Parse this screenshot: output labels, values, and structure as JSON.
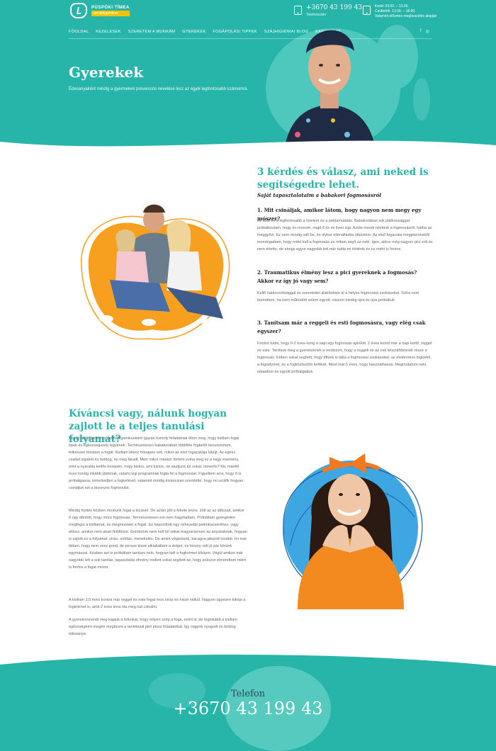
{
  "brand": {
    "name": "PÜSPÖKI TÍMEA",
    "tagline": "dentálhigiénikus",
    "accent_color": "#27b5aa",
    "secondary_color": "#f7a01f"
  },
  "header": {
    "phone": "+3670 43 199 43",
    "phone_label": "Telefonszám",
    "hours_line1": "Kedd: 09.00. – 13.00.",
    "hours_line2": "Csütörtök: 13.00. – 18.00.",
    "hours_line3": "Valamint előzetes megbeszélés alapján"
  },
  "nav": {
    "items": [
      "FŐOLDAL",
      "KEZELÉSEK",
      "SZERETEM A MUNKÁM",
      "GYEREKEK",
      "FOGÁPOLÁSI TIPPEK",
      "SZÁJHIGIÉNIAI BLOG",
      "KAPCSOLAT"
    ],
    "social": [
      "f",
      "instagram"
    ]
  },
  "hero": {
    "title": "Gyerekek",
    "lead": "Édesanyaként mindig a gyermekek prevenciós nevelése lesz az egyik legfontosabb számomra."
  },
  "section1": {
    "title": "3 kérdés és válasz, ami neked is segítségedre lehet.",
    "subtitle": "Saját tapasztalataim a babakori fogmosásról",
    "q1": "1. Mit csináljak, amikor látom, hogy nagyon nem megy egy mószer?",
    "a1": "Az első és a legfontosabb a türelem és a példamutatás. Babakorában sok játékossággal próbálkoztam, hogy én mosom, majd ő és mi ilyen izgi. Aztán mesét néztünk a fogmosásról, hátha az meggyőzi. Ez nem mindig vált be, és olykor ellenállásba ütköztem. Az első fogacska megjelenésétől mondogattam, hogy miért kell a fogmosás és miben segít az neki. Igen, akkor még nagyon pici volt és nem értette, de ahogy egyre nagyobb lett már tudta mi történik és ez miért is fontos.",
    "q2": "2. Traumatikus élmény lesz a pici gyereknek a fogmosás? Akkor ez így jó vagy sem?",
    "a2": "Kellő határozottsággal és szeretettel alakítottam ki a helyes fogmosási szokásokat. Soha nem büntettem, ha nem működött velem együtt, viszont mindig újra és újra próbáltuk.",
    "q3": "3. Tanítsam már a reggeli és esti fogmosásra, vagy elég csak egyszer?",
    "a3": "Fontos tudni, hogy 0-2 éves korig a napi egy fogmosás ajánlott. 2 éves kortól már a napi kettő, reggel és este. Tanítsuk meg a gyerekeknek a rendszert, hogy a reggeli és az esti készülődésnek része a fogmosás. Ebben sokat segített, hogy tőlünk is látta a fogmosási szokásokat, az elektromos fogkefét, a fogselymet, és a fogköztisztító kefékét. Most már 5 éves, hogy használhassa. Megmutatom neki, odaadom és együtt próbálgatjuk."
  },
  "section2": {
    "title": "Kíváncsi vagy, nálunk hogyan zajlott le a teljes tanulási folyamat?",
    "p1": "Kezdő anyukaként és dentálhigiénikusként igazán komoly feladatnak élem meg, hogy kisfiam fogai épek és egészségesek legyenek. Természetesen babakorában többféle fogkefét beszereztem, felkészen mostam a fogát. Kisfiam kilenc hónapos volt, mikor az első fogacskája kibújt. Az egész család izgatott és boldog, no meg fáradt. Mert mikor máskor történt volna meg ez a nagy esemény, mint a nyaralás kellős közepén, hogy biztos, ami biztos, ne aludjunk túl sokat. Ismerős? Kb. másfél éves koráig inkább játéknak, valami izgi programnak fogta fel a fogmosást. Figyeltem arra, hogy ő is próbálgassa, ismerkedjen a fogkefével, valamint mindig kíváncsian szemlélte, hogy mi szülők hogyan csináljuk ezt a bizonyos fogmosást.",
    "p2": "Mindig fürdés közben mostunk fogat a kicsivel. De aztán jött a fekete leves. Jött az az időszak, amikor ő úgy döntött, hogy nincs fogmosás. Természetesen ezt nem hagyhattam. Próbáltam gyengéden megfogni a kisfiamat, és megmostam a fogát. Ez hasonlított egy nehezebb pelenkacseréhez, vagy ahhoz, amikor nem akart felöltözni. Gondolom nem kell túl sokat magyaráznom az anyukáknak, hogyan is zajlott ez a folyamat: sírás, ordítás, menekülés. De amint végeztünk, kacagva játszott tovább. Ím mar láttam, hogy nem vesz gond, de persze kissé elkiabáltam a dolgot, és bizony volt jó pár körünk egymással. Közben azt is próbáltam tanítani neki, hogyan kell a fogkrémet kiköpni. Végül amikor már nagyobb lett a sok tanítás, tapasztalás élmény mellett sokat segített az, hogy sokszor elmondtam miért is fontos a fogat mosni.",
    "p3": "A kisfiam 2,5 éves korára már reggel és este fogat mos sírás és hiszti nélkül. Nagyon ügyesen kiköpi a fogkrémet is, amit 2 éves kora óta meg tud csinálni.",
    "p4": "A gyerekorvosnál meg kapjuk a bókokat, hogy milyen szép a foga, ezért is, de leginkább a kisfiam egészségéért megéri megbozni a tanítással járó plusz feladatokat. Így vagyok nyugodt és boldog édesanya."
  },
  "footer": {
    "label": "Telefon",
    "phone": "+3670 43 199 43"
  }
}
